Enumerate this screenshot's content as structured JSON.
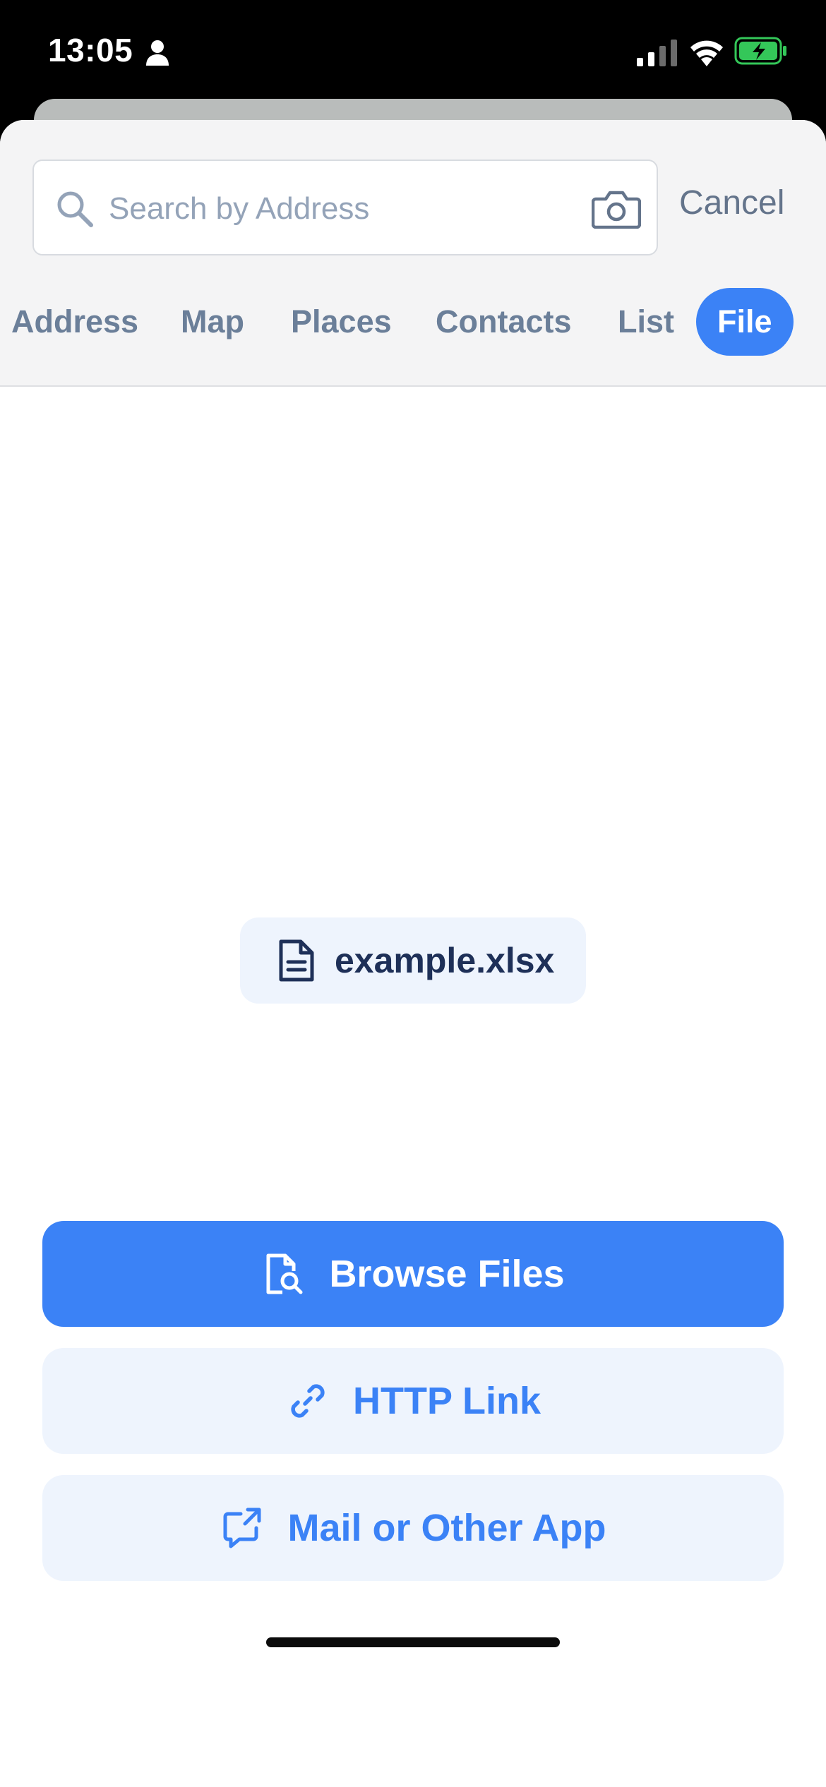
{
  "status_bar": {
    "time": "13:05"
  },
  "search": {
    "placeholder": "Search by Address",
    "value": "",
    "cancel_label": "Cancel"
  },
  "tabs": [
    {
      "label": "Address",
      "active": false
    },
    {
      "label": "Map",
      "active": false
    },
    {
      "label": "Places",
      "active": false
    },
    {
      "label": "Contacts",
      "active": false
    },
    {
      "label": "List",
      "active": false
    },
    {
      "label": "File",
      "active": true
    }
  ],
  "file": {
    "name": "example.xlsx",
    "icon": "document-icon"
  },
  "actions": {
    "browse_label": "Browse Files",
    "http_label": "HTTP Link",
    "mail_label": "Mail or Other App"
  },
  "colors": {
    "accent": "#3b82f6",
    "accent_light": "#eef4fd",
    "tab_inactive": "#6b7f99",
    "file_text": "#1e3058",
    "battery_green": "#34c759"
  }
}
